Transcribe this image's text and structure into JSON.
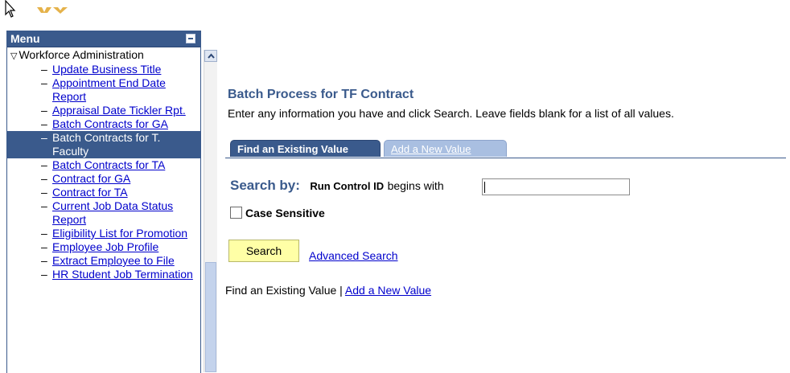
{
  "menu": {
    "title": "Menu",
    "folder": "Workforce Administration",
    "items": [
      "Update Business Title",
      "Appointment End Date Report",
      "Appraisal Date Tickler Rpt.",
      "Batch Contracts for GA",
      "Batch Contracts for T. Faculty",
      "Batch Contracts for TA",
      "Contract for GA",
      "Contract for TA",
      "Current Job Data Status Report",
      "Eligibility List for Promotion",
      "Employee Job Profile",
      "Extract Employee to File",
      "HR Student Job Termination"
    ]
  },
  "page": {
    "title": "Batch Process for TF Contract",
    "instructions": "Enter any information you have and click Search. Leave fields blank for a list of all values."
  },
  "tabs": {
    "find": "Find an Existing Value",
    "add": "Add a New Value"
  },
  "search": {
    "search_by": "Search by:",
    "field_label": "Run Control ID",
    "operator": "begins with",
    "value": "",
    "case_sensitive": "Case Sensitive",
    "button": "Search",
    "advanced": "Advanced Search"
  },
  "bottom": {
    "find": "Find an Existing Value",
    "separator": "|",
    "add": "Add a New Value"
  },
  "colors": {
    "menu_header": "#3a5a8c",
    "link": "#0000cc",
    "search_button": "#ffffa6",
    "title": "#3a5a8c"
  },
  "icons": [
    "mouse-pointer-icon",
    "logo-icon",
    "collapse-icon",
    "expanded-triangle-icon",
    "scroll-up-arrow-icon"
  ]
}
